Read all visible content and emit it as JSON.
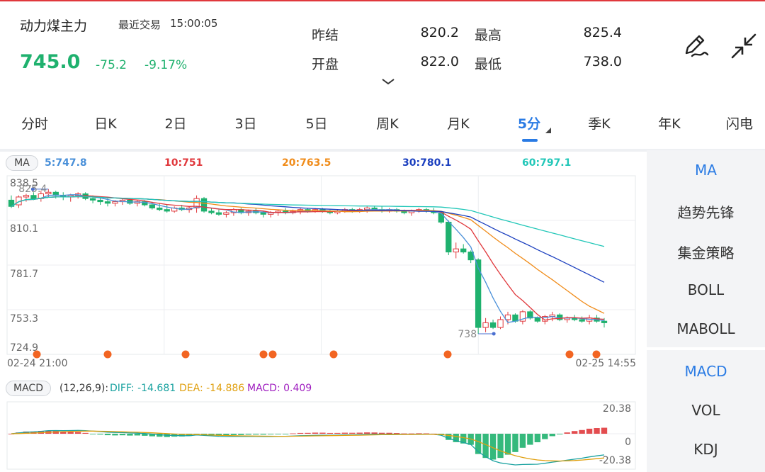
{
  "header": {
    "name": "动力煤主力",
    "last_trade_label": "最近交易",
    "time": "15:00:05",
    "price": "745.0",
    "change": "-75.2",
    "change_pct": "-9.17%",
    "stats": [
      {
        "label": "昨结",
        "value": "820.2"
      },
      {
        "label": "最高",
        "value": "825.4"
      },
      {
        "label": "开盘",
        "value": "822.0"
      },
      {
        "label": "最低",
        "value": "738.0"
      }
    ],
    "icons": [
      "draw-icon",
      "collapse-icon"
    ]
  },
  "tabs": [
    "分时",
    "日K",
    "2日",
    "3日",
    "5日",
    "周K",
    "月K",
    "5分",
    "季K",
    "年K",
    "闪电"
  ],
  "active_tab": "5分",
  "ma_legend": {
    "label": "MA",
    "items": [
      {
        "text": "5:747.8",
        "color": "#4a90d9"
      },
      {
        "text": "10:751",
        "color": "#e0383c"
      },
      {
        "text": "20:763.5",
        "color": "#f08c1a"
      },
      {
        "text": "30:780.1",
        "color": "#1b3fbf"
      },
      {
        "text": "60:797.1",
        "color": "#22c7b8"
      }
    ]
  },
  "main_chart": {
    "y_ticks": [
      "838.5",
      "810.1",
      "781.7",
      "753.3",
      "724.9"
    ],
    "high_label": "825.4",
    "low_label": "738",
    "x_start": "02-24 21:00",
    "x_end": "02-25 14:55"
  },
  "macd_legend": {
    "label": "MACD",
    "params": "(12,26,9):",
    "diff": "DIFF: -14.681",
    "dea": "DEA: -14.886",
    "macd": "MACD: 0.409"
  },
  "macd_chart": {
    "y_ticks": [
      "20.38",
      "0",
      "-20.38"
    ]
  },
  "right_panel": {
    "top_items": [
      "MA",
      "趋势先锋",
      "集金策略",
      "BOLL",
      "MABOLL"
    ],
    "bottom_items": [
      "MACD",
      "VOL",
      "KDJ"
    ],
    "active_top": "MA",
    "active_bottom": "MACD"
  },
  "colors": {
    "up": "#e0383c",
    "down": "#1fb16e",
    "accent": "#2a7be4",
    "marker": "#f26522"
  },
  "chart_data": {
    "type": "candlestick",
    "price_range": [
      724.9,
      838.5
    ],
    "ohlc": [
      [
        823,
        826,
        818,
        819
      ],
      [
        820,
        826,
        818,
        825
      ],
      [
        825,
        827,
        822,
        826
      ],
      [
        826,
        828,
        823,
        824
      ],
      [
        824,
        829,
        822,
        827
      ],
      [
        827,
        830,
        825,
        828
      ],
      [
        828,
        829,
        824,
        826
      ],
      [
        826,
        828,
        823,
        825
      ],
      [
        825,
        827,
        822,
        826
      ],
      [
        826,
        828,
        824,
        827
      ],
      [
        827,
        828,
        823,
        824
      ],
      [
        824,
        826,
        821,
        823
      ],
      [
        823,
        825,
        820,
        822
      ],
      [
        822,
        824,
        819,
        821
      ],
      [
        821,
        823,
        819,
        822
      ],
      [
        822,
        824,
        820,
        823
      ],
      [
        823,
        824,
        820,
        821
      ],
      [
        821,
        823,
        819,
        822
      ],
      [
        822,
        823,
        819,
        820
      ],
      [
        820,
        822,
        817,
        818
      ],
      [
        818,
        821,
        816,
        817
      ],
      [
        817,
        820,
        815,
        816
      ],
      [
        816,
        819,
        815,
        818
      ],
      [
        818,
        820,
        816,
        817
      ],
      [
        817,
        819,
        815,
        818
      ],
      [
        818,
        826,
        815,
        824
      ],
      [
        824,
        825,
        815,
        816
      ],
      [
        816,
        818,
        814,
        815
      ],
      [
        815,
        817,
        813,
        814
      ],
      [
        814,
        816,
        812,
        815
      ],
      [
        815,
        818,
        813,
        817
      ],
      [
        817,
        818,
        814,
        815
      ],
      [
        815,
        817,
        813,
        816
      ],
      [
        816,
        818,
        814,
        815
      ],
      [
        815,
        816,
        812,
        814
      ],
      [
        814,
        816,
        812,
        815
      ],
      [
        815,
        817,
        813,
        816
      ],
      [
        816,
        818,
        814,
        815
      ],
      [
        815,
        817,
        814,
        816
      ],
      [
        816,
        818,
        814,
        817
      ],
      [
        817,
        818,
        815,
        816
      ],
      [
        816,
        818,
        815,
        817
      ],
      [
        817,
        818,
        815,
        816
      ],
      [
        816,
        817,
        814,
        815
      ],
      [
        815,
        817,
        814,
        816
      ],
      [
        816,
        818,
        815,
        817
      ],
      [
        817,
        818,
        815,
        816
      ],
      [
        816,
        818,
        815,
        817
      ],
      [
        817,
        819,
        815,
        818
      ],
      [
        818,
        819,
        816,
        817
      ],
      [
        817,
        819,
        815,
        816
      ],
      [
        816,
        818,
        815,
        817
      ],
      [
        817,
        818,
        815,
        816
      ],
      [
        816,
        817,
        814,
        815
      ],
      [
        815,
        817,
        813,
        816
      ],
      [
        816,
        818,
        815,
        817
      ],
      [
        817,
        818,
        815,
        816
      ],
      [
        816,
        818,
        814,
        815
      ],
      [
        815,
        816,
        808,
        809
      ],
      [
        809,
        810,
        788,
        790
      ],
      [
        790,
        796,
        786,
        792
      ],
      [
        792,
        795,
        789,
        790
      ],
      [
        790,
        791,
        783,
        785
      ],
      [
        785,
        786,
        738,
        742
      ],
      [
        742,
        748,
        739,
        745
      ],
      [
        745,
        747,
        741,
        742
      ],
      [
        742,
        749,
        741,
        747
      ],
      [
        747,
        752,
        744,
        750
      ],
      [
        750,
        751,
        745,
        746
      ],
      [
        746,
        753,
        744,
        752
      ],
      [
        752,
        753,
        747,
        748
      ],
      [
        748,
        749,
        745,
        746
      ],
      [
        746,
        750,
        744,
        749
      ],
      [
        749,
        752,
        746,
        750
      ],
      [
        750,
        751,
        746,
        747
      ],
      [
        747,
        749,
        745,
        748
      ],
      [
        748,
        750,
        746,
        747
      ],
      [
        747,
        749,
        745,
        746
      ],
      [
        746,
        750,
        744,
        748
      ],
      [
        748,
        750,
        745,
        746
      ],
      [
        746,
        748,
        742,
        745
      ]
    ],
    "ma_last": {
      "MA5": 747.8,
      "MA10": 751,
      "MA20": 763.5,
      "MA30": 780.1,
      "MA60": 797.1
    },
    "macd_last": {
      "DIFF": -14.681,
      "DEA": -14.886,
      "MACD": 0.409
    },
    "macd_range": [
      -20.38,
      20.38
    ]
  }
}
